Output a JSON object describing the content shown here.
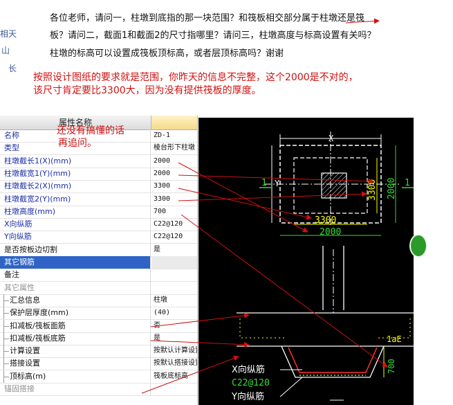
{
  "sidebar_fragments": [
    "相天",
    "山",
    "长"
  ],
  "question_lines": [
    "各位老师，请问一，柱墩到底指的那一块范围？和筏板相交部分属于柱墩还是筏",
    "板？请问二，截面1和截面2的尺寸指哪里？请问三，柱墩高度与标高设置有关吗？",
    "柱墩的标高可以设置成筏板顶标高，或者层顶标高吗？谢谢"
  ],
  "answer_lines": [
    "按照设计图纸的要求就是范围，你昨天的信息不完整，这个2000是不对的，",
    "该尺寸肯定要比3300大，因为没有提供筏板的厚度。"
  ],
  "note_lines": [
    "还没有搞懂的话",
    "再追问。"
  ],
  "grid": {
    "header": "属性名称",
    "rows": [
      {
        "name": "名称",
        "value": "ZD-1",
        "style": "blue"
      },
      {
        "name": "类型",
        "value": "棱台形下柱墩",
        "style": "blue"
      },
      {
        "name": "柱墩截长1(X)(mm)",
        "value": "2000",
        "style": "blue"
      },
      {
        "name": "柱墩截宽1(Y)(mm)",
        "value": "2000",
        "style": "blue"
      },
      {
        "name": "柱墩截长2(X)(mm)",
        "value": "3300",
        "style": "blue"
      },
      {
        "name": "柱墩截宽2(Y)(mm)",
        "value": "3300",
        "style": "blue"
      },
      {
        "name": "柱墩高度(mm)",
        "value": "700",
        "style": "blue"
      },
      {
        "name": "X向纵筋",
        "value": "C22@120",
        "style": "blue"
      },
      {
        "name": "Y向纵筋",
        "value": "C22@120",
        "style": "blue"
      },
      {
        "name": "是否按板边切割",
        "value": "是",
        "style": "black"
      },
      {
        "name": "其它钢筋",
        "value": "",
        "style": "sel"
      },
      {
        "name": "备注",
        "value": "",
        "style": "black"
      },
      {
        "name": "其它属性",
        "value": "",
        "style": "gray"
      },
      {
        "name": "汇总信息",
        "value": "柱墩",
        "style": "child"
      },
      {
        "name": "保护层厚度(mm)",
        "value": "(40)",
        "style": "child"
      },
      {
        "name": "扣减板/筏板面筋",
        "value": "否",
        "style": "child"
      },
      {
        "name": "扣减板/筏板底筋",
        "value": "是",
        "style": "child"
      },
      {
        "name": "计算设置",
        "value": "按默认计算设置",
        "style": "child"
      },
      {
        "name": "搭接设置",
        "value": "按默认搭接设置",
        "style": "child"
      },
      {
        "name": "顶标高(m)",
        "value": "筏板底标高",
        "style": "child"
      },
      {
        "name": "锚固搭接",
        "value": "",
        "style": "gray"
      }
    ]
  },
  "drawing": {
    "dim_x": "X",
    "dim_y": "Y",
    "section_mark": "1",
    "dim_3300_h": "3300",
    "dim_2000_h": "2000",
    "dim_3300_v": "3300",
    "dim_2000_v": "2000",
    "lae": "1aE",
    "dim_700": "700",
    "x_rebar": "X向纵筋",
    "rebar_spec": "C22@120",
    "y_rebar": "Y向纵筋"
  },
  "colors": {
    "annotation_red": "#d01010",
    "grid_blue": "#1c2fa8",
    "cad_yellow": "#ffff00",
    "cad_green": "#33dd33",
    "selection_blue": "#2f64c6"
  }
}
